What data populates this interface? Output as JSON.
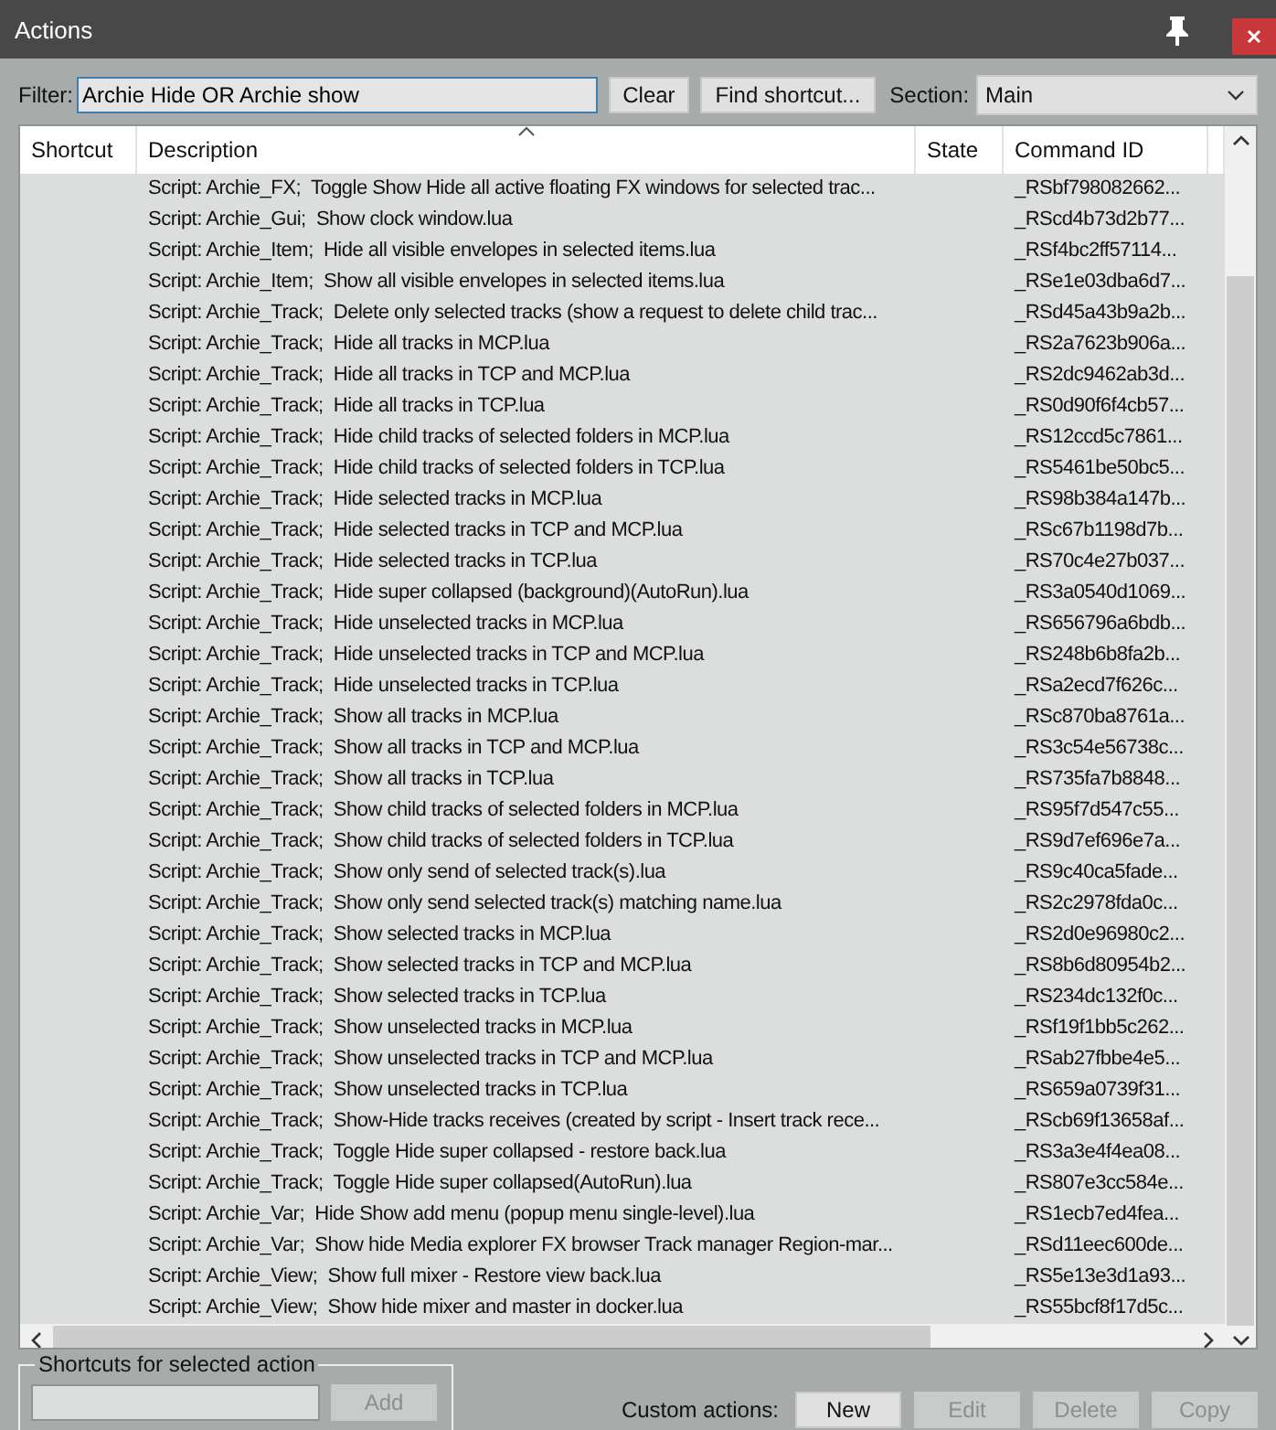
{
  "window": {
    "title": "Actions"
  },
  "filter": {
    "label": "Filter:",
    "value": "Archie Hide OR Archie show"
  },
  "buttons": [
    {
      "label": "Clear"
    },
    {
      "label": "Find shortcut..."
    }
  ],
  "section": {
    "label": "Section:",
    "value": "Main"
  },
  "table": {
    "columns": [
      "Shortcut",
      "Description",
      "State",
      "Command ID"
    ],
    "rows": [
      {
        "description": "Script: Archie_FX;  Toggle Show Hide all active floating FX windows for selected trac...",
        "command_id": "_RSbf798082662..."
      },
      {
        "description": "Script: Archie_Gui;  Show clock window.lua",
        "command_id": "_RScd4b73d2b77..."
      },
      {
        "description": "Script: Archie_Item;  Hide all visible envelopes in selected items.lua",
        "command_id": "_RSf4bc2ff57114..."
      },
      {
        "description": "Script: Archie_Item;  Show all visible envelopes in selected items.lua",
        "command_id": "_RSe1e03dba6d7..."
      },
      {
        "description": "Script: Archie_Track;  Delete only selected tracks (show a request to delete child trac...",
        "command_id": "_RSd45a43b9a2b..."
      },
      {
        "description": "Script: Archie_Track;  Hide all tracks in MCP.lua",
        "command_id": "_RS2a7623b906a..."
      },
      {
        "description": "Script: Archie_Track;  Hide all tracks in TCP and MCP.lua",
        "command_id": "_RS2dc9462ab3d..."
      },
      {
        "description": "Script: Archie_Track;  Hide all tracks in TCP.lua",
        "command_id": "_RS0d90f6f4cb57..."
      },
      {
        "description": "Script: Archie_Track;  Hide child tracks of selected folders in MCP.lua",
        "command_id": "_RS12ccd5c7861..."
      },
      {
        "description": "Script: Archie_Track;  Hide child tracks of selected folders in TCP.lua",
        "command_id": "_RS5461be50bc5..."
      },
      {
        "description": "Script: Archie_Track;  Hide selected tracks in MCP.lua",
        "command_id": "_RS98b384a147b..."
      },
      {
        "description": "Script: Archie_Track;  Hide selected tracks in TCP and MCP.lua",
        "command_id": "_RSc67b1198d7b..."
      },
      {
        "description": "Script: Archie_Track;  Hide selected tracks in TCP.lua",
        "command_id": "_RS70c4e27b037..."
      },
      {
        "description": "Script: Archie_Track;  Hide super collapsed (background)(AutoRun).lua",
        "command_id": "_RS3a0540d1069..."
      },
      {
        "description": "Script: Archie_Track;  Hide unselected tracks in MCP.lua",
        "command_id": "_RS656796a6bdb..."
      },
      {
        "description": "Script: Archie_Track;  Hide unselected tracks in TCP and MCP.lua",
        "command_id": "_RS248b6b8fa2b..."
      },
      {
        "description": "Script: Archie_Track;  Hide unselected tracks in TCP.lua",
        "command_id": "_RSa2ecd7f626c..."
      },
      {
        "description": "Script: Archie_Track;  Show all tracks in MCP.lua",
        "command_id": "_RSc870ba8761a..."
      },
      {
        "description": "Script: Archie_Track;  Show all tracks in TCP and MCP.lua",
        "command_id": "_RS3c54e56738c..."
      },
      {
        "description": "Script: Archie_Track;  Show all tracks in TCP.lua",
        "command_id": "_RS735fa7b8848..."
      },
      {
        "description": "Script: Archie_Track;  Show child tracks of selected folders in MCP.lua",
        "command_id": "_RS95f7d547c55..."
      },
      {
        "description": "Script: Archie_Track;  Show child tracks of selected folders in TCP.lua",
        "command_id": "_RS9d7ef696e7a..."
      },
      {
        "description": "Script: Archie_Track;  Show only send of selected track(s).lua",
        "command_id": "_RS9c40ca5fade..."
      },
      {
        "description": "Script: Archie_Track;  Show only send selected track(s) matching name.lua",
        "command_id": "_RS2c2978fda0c..."
      },
      {
        "description": "Script: Archie_Track;  Show selected tracks in MCP.lua",
        "command_id": "_RS2d0e96980c2..."
      },
      {
        "description": "Script: Archie_Track;  Show selected tracks in TCP and MCP.lua",
        "command_id": "_RS8b6d80954b2..."
      },
      {
        "description": "Script: Archie_Track;  Show selected tracks in TCP.lua",
        "command_id": "_RS234dc132f0c..."
      },
      {
        "description": "Script: Archie_Track;  Show unselected tracks in MCP.lua",
        "command_id": "_RSf19f1bb5c262..."
      },
      {
        "description": "Script: Archie_Track;  Show unselected tracks in TCP and MCP.lua",
        "command_id": "_RSab27fbbe4e5..."
      },
      {
        "description": "Script: Archie_Track;  Show unselected tracks in TCP.lua",
        "command_id": "_RS659a0739f31..."
      },
      {
        "description": "Script: Archie_Track;  Show-Hide tracks receives (created by script - Insert track rece...",
        "command_id": "_RScb69f13658af..."
      },
      {
        "description": "Script: Archie_Track;  Toggle Hide super collapsed - restore back.lua",
        "command_id": "_RS3a3e4f4ea08..."
      },
      {
        "description": "Script: Archie_Track;  Toggle Hide super collapsed(AutoRun).lua",
        "command_id": "_RS807e3cc584e..."
      },
      {
        "description": "Script: Archie_Var;  Hide Show add menu (popup menu single-level).lua",
        "command_id": "_RS1ecb7ed4fea..."
      },
      {
        "description": "Script: Archie_Var;  Show hide Media explorer FX browser Track manager Region-mar...",
        "command_id": "_RSd11eec600de..."
      },
      {
        "description": "Script: Archie_View;  Show full mixer - Restore view back.lua",
        "command_id": "_RS5e13e3d1a93..."
      },
      {
        "description": "Script: Archie_View;  Show hide mixer and master in docker.lua",
        "command_id": "_RS55bcf8f17d5c..."
      }
    ]
  },
  "shortcuts_group": {
    "title": "Shortcuts for selected action",
    "add": {
      "label": "Add",
      "disabled": true
    }
  },
  "custom_actions": {
    "label": "Custom actions:",
    "buttons": [
      {
        "label": "New",
        "disabled": false
      },
      {
        "label": "Edit",
        "disabled": true
      },
      {
        "label": "Delete",
        "disabled": true
      },
      {
        "label": "Copy",
        "disabled": true
      }
    ]
  }
}
